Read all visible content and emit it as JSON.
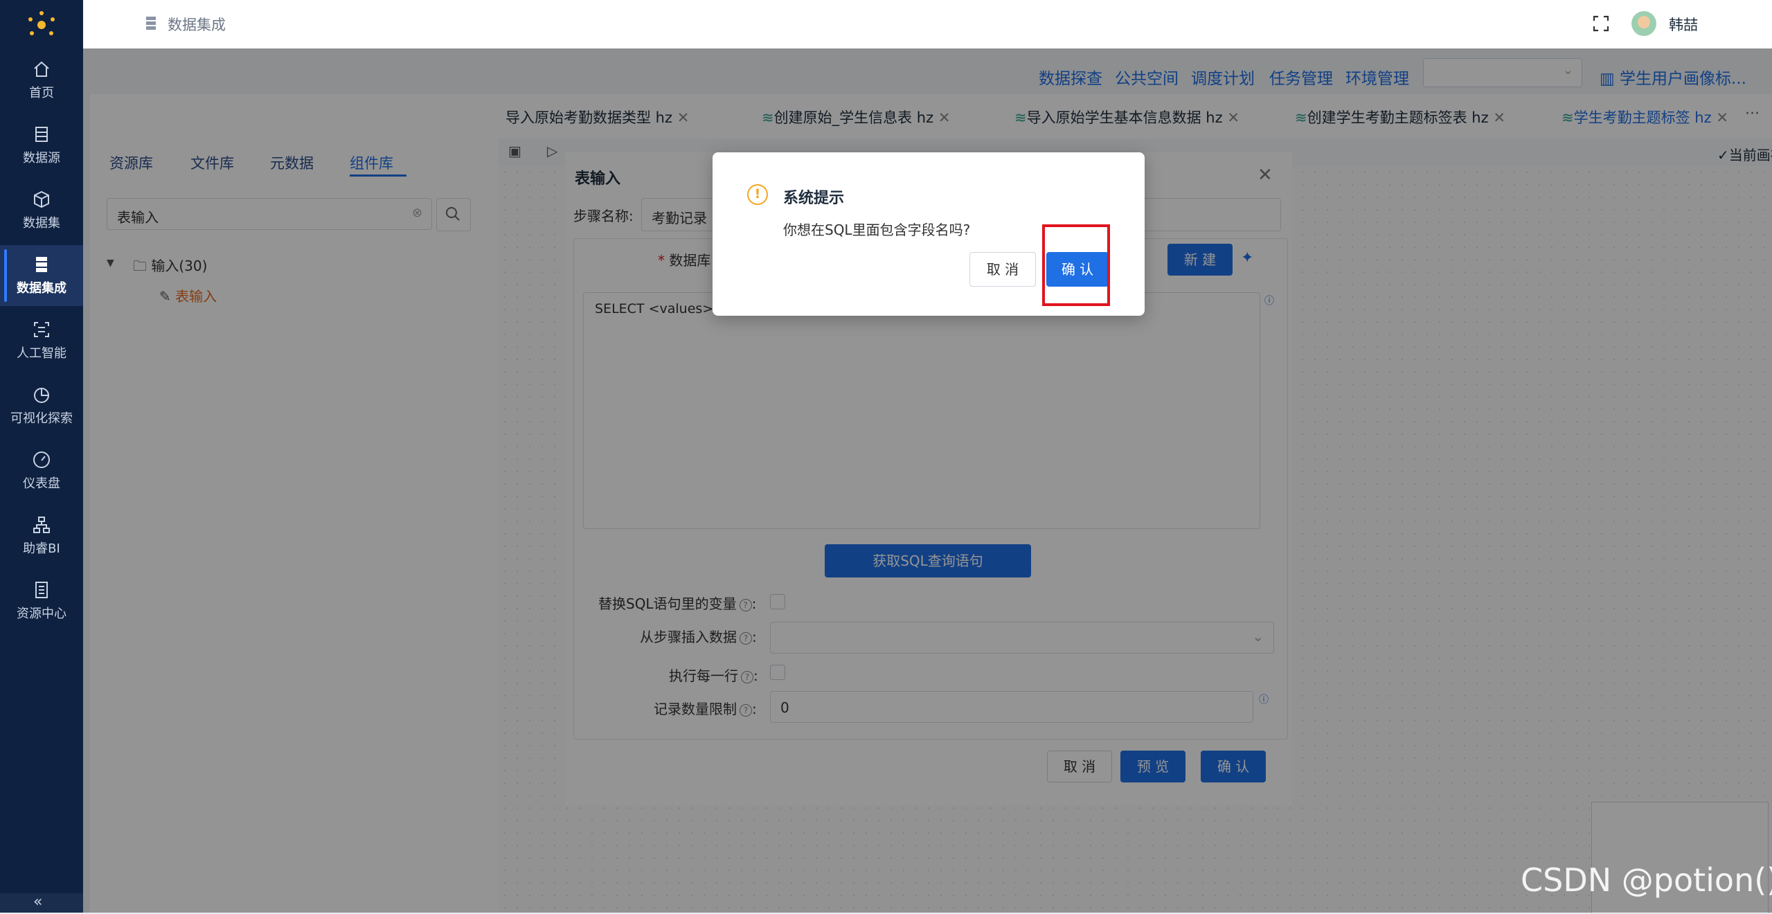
{
  "sidebar": {
    "items": [
      {
        "label": "首页",
        "icon": "home-icon"
      },
      {
        "label": "数据源",
        "icon": "database-icon"
      },
      {
        "label": "数据集",
        "icon": "cube-icon"
      },
      {
        "label": "数据集成",
        "icon": "server-icon",
        "active": true
      },
      {
        "label": "人工智能",
        "icon": "ai-scan-icon"
      },
      {
        "label": "可视化探索",
        "icon": "pie-chart-icon"
      },
      {
        "label": "仪表盘",
        "icon": "gauge-icon"
      },
      {
        "label": "助睿BI",
        "icon": "org-chart-icon"
      },
      {
        "label": "资源中心",
        "icon": "folder-stack-icon"
      }
    ]
  },
  "header": {
    "breadcrumb": "数据集成",
    "user_name": "韩喆"
  },
  "toplinks": [
    "数据探查",
    "公共空间",
    "调度计划",
    "任务管理",
    "环境管理"
  ],
  "flow_title": "学生用户画像标...",
  "left_tabs": [
    "资源库",
    "文件库",
    "元数据",
    "组件库"
  ],
  "search": {
    "value": "表输入"
  },
  "tree": {
    "folder": "输入(30)",
    "item": "表输入"
  },
  "editor_tabs": [
    "导入原始考勤数据类型 hz",
    "创建原始_学生信息表 hz",
    "导入原始学生基本信息数据 hz",
    "创建学生考勤主题标签表 hz",
    "学生考勤主题标签 hz"
  ],
  "more_tabs": "···",
  "saved_status": "当前画布已保存",
  "table_input": {
    "title": "表输入",
    "step_name_label": "步骤名称:",
    "step_name_value": "考勤记录",
    "db_label": "数据库",
    "new_button": "新 建",
    "sql_text": "SELECT <values> F",
    "get_sql_button": "获取SQL查询语句",
    "replace_var_label": "替换SQL语句里的变量",
    "insert_from_step_label": "从步骤插入数据",
    "exec_each_row_label": "执行每一行",
    "record_limit_label": "记录数量限制",
    "record_limit_value": "0",
    "cancel": "取 消",
    "preview": "预 览",
    "confirm": "确 认"
  },
  "confirm_dialog": {
    "title": "系统提示",
    "message": "你想在SQL里面包含字段名吗?",
    "cancel": "取 消",
    "ok": "确 认"
  },
  "watermark": "CSDN @potion()",
  "colors": {
    "sidebar": "#0f2140",
    "primary": "#1f6fe5",
    "highlight": "#e0141e",
    "warning": "#f5a623"
  }
}
